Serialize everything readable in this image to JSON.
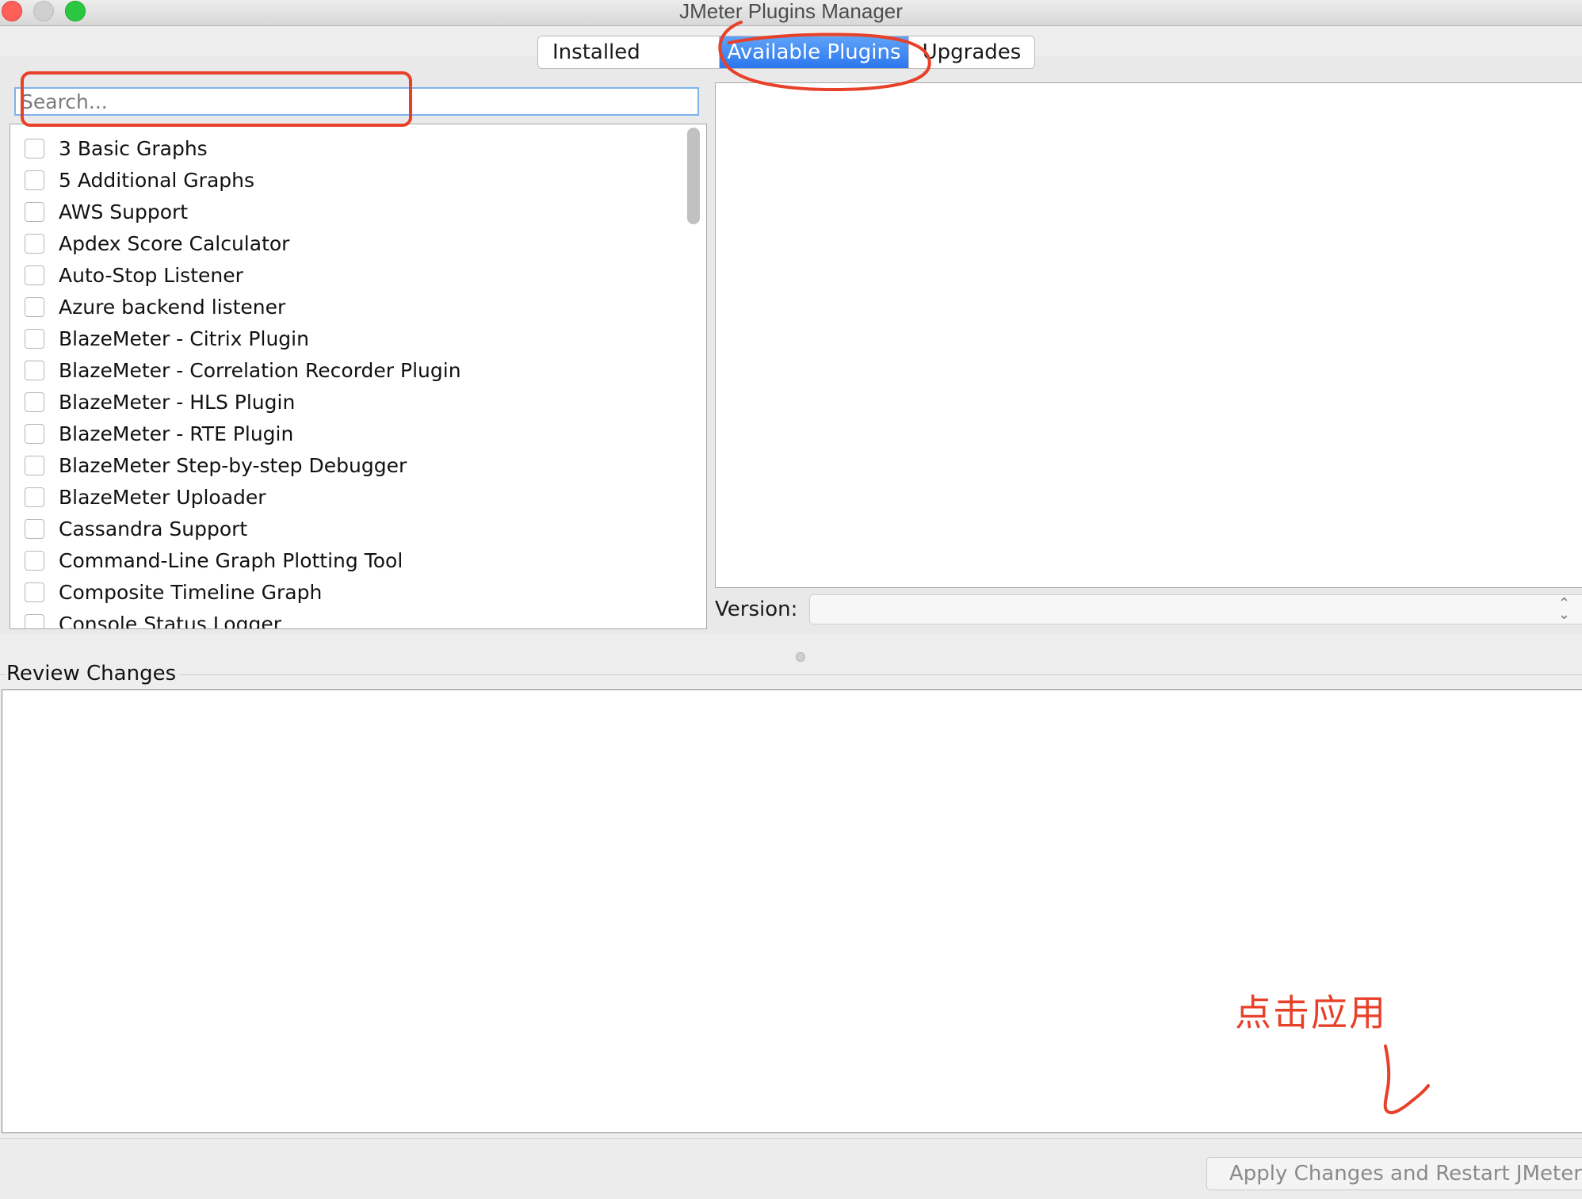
{
  "window": {
    "title": "JMeter Plugins Manager"
  },
  "tabs": [
    {
      "label": "Installed Plugins",
      "active": false
    },
    {
      "label": "Available Plugins",
      "active": true
    },
    {
      "label": "Upgrades",
      "active": false
    }
  ],
  "search": {
    "placeholder": "Search...",
    "value": ""
  },
  "plugins": [
    {
      "label": "3 Basic Graphs",
      "checked": false
    },
    {
      "label": "5 Additional Graphs",
      "checked": false
    },
    {
      "label": "AWS Support",
      "checked": false
    },
    {
      "label": "Apdex Score Calculator",
      "checked": false
    },
    {
      "label": "Auto-Stop Listener",
      "checked": false
    },
    {
      "label": "Azure backend listener",
      "checked": false
    },
    {
      "label": "BlazeMeter - Citrix Plugin",
      "checked": false
    },
    {
      "label": "BlazeMeter - Correlation Recorder Plugin",
      "checked": false
    },
    {
      "label": "BlazeMeter - HLS Plugin",
      "checked": false
    },
    {
      "label": "BlazeMeter - RTE Plugin",
      "checked": false
    },
    {
      "label": "BlazeMeter Step-by-step Debugger",
      "checked": false
    },
    {
      "label": "BlazeMeter Uploader",
      "checked": false
    },
    {
      "label": "Cassandra Support",
      "checked": false
    },
    {
      "label": "Command-Line Graph Plotting Tool",
      "checked": false
    },
    {
      "label": "Composite Timeline Graph",
      "checked": false
    },
    {
      "label": "Console Status Logger",
      "checked": false
    }
  ],
  "details": {
    "version_label": "Version:",
    "version_value": ""
  },
  "review": {
    "title": "Review Changes"
  },
  "actions": {
    "apply_label": "Apply Changes and Restart JMeter"
  },
  "annotation": {
    "text": "点击应用",
    "color": "#e8412a"
  },
  "colors": {
    "tab_active": "#2b76ef",
    "annotation_red": "#e8412a"
  }
}
